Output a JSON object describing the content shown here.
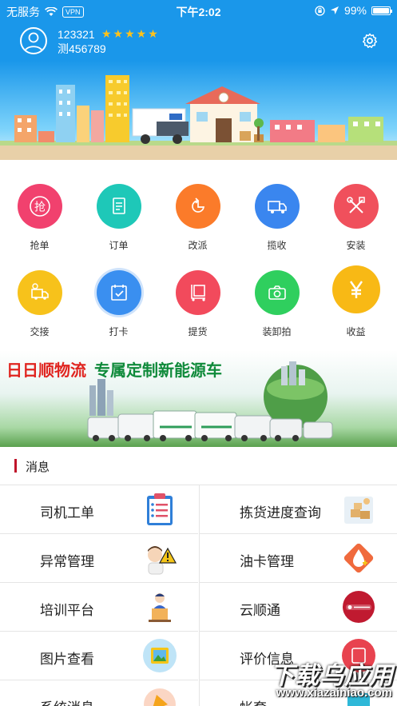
{
  "statusbar": {
    "carrier": "无服务",
    "vpn": "VPN",
    "time": "下午2:02",
    "battery_pct": "99%",
    "battery_level": 0.99
  },
  "user": {
    "id": "123321",
    "name": "测456789",
    "rating": 5,
    "stars": "★★★★★"
  },
  "grid": [
    {
      "label": "抢单",
      "color": "#f1416e",
      "icon": "grab-order-icon"
    },
    {
      "label": "订单",
      "color": "#1ec8b8",
      "icon": "order-document-icon"
    },
    {
      "label": "改派",
      "color": "#fb7b2a",
      "icon": "reassign-icon"
    },
    {
      "label": "揽收",
      "color": "#3a86ef",
      "icon": "truck-icon"
    },
    {
      "label": "安装",
      "color": "#f0505c",
      "icon": "tools-icon"
    },
    {
      "label": "交接",
      "color": "#f7c21b",
      "icon": "handover-truck-icon"
    },
    {
      "label": "打卡",
      "color": "#3a8ff0",
      "icon": "checkin-calendar-icon"
    },
    {
      "label": "提货",
      "color": "#f24a5c",
      "icon": "pickup-cart-icon"
    },
    {
      "label": "装卸拍",
      "color": "#2fcf5e",
      "icon": "camera-icon"
    },
    {
      "label": "收益",
      "color": "#f8b915",
      "icon": "yen-icon"
    }
  ],
  "ad": {
    "brand": "日日顺物流",
    "slogan": "专属定制新能源车"
  },
  "section": {
    "title": "消息"
  },
  "list": [
    {
      "label": "司机工单",
      "icon": "driver-worksheet-icon"
    },
    {
      "label": "拣货进度查询",
      "icon": "picking-progress-icon"
    },
    {
      "label": "异常管理",
      "icon": "exception-warning-icon"
    },
    {
      "label": "油卡管理",
      "icon": "fuel-card-icon"
    },
    {
      "label": "培训平台",
      "icon": "training-platform-icon"
    },
    {
      "label": "云顺通",
      "icon": "yunshuntong-logo-icon"
    },
    {
      "label": "图片查看",
      "icon": "image-view-icon"
    },
    {
      "label": "评价信息",
      "icon": "evaluation-icon"
    },
    {
      "label": "系统消息",
      "icon": "system-message-icon"
    },
    {
      "label": "帐套",
      "icon": "account-set-icon"
    }
  ],
  "watermark": {
    "main": "下载乌应用",
    "url": "www.xiazainiao.com"
  }
}
